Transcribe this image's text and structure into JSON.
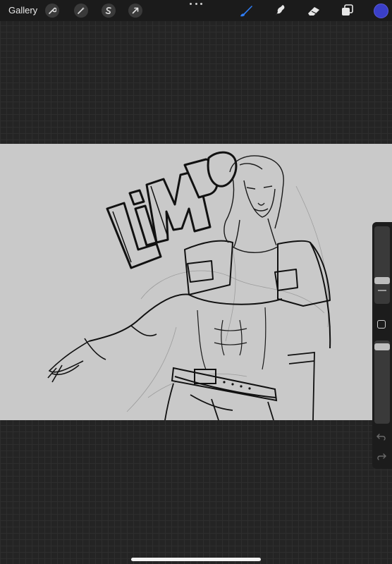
{
  "topbar": {
    "gallery_label": "Gallery",
    "left_tools": [
      "wrench-icon",
      "magic-wand-icon",
      "selection-s-icon",
      "transform-arrow-icon"
    ],
    "right_tools": [
      "brush-icon",
      "smudge-icon",
      "eraser-icon",
      "layers-icon"
    ],
    "active_tool": "brush-icon",
    "active_color": "#3a3fc8",
    "accent_color": "#2f7df5"
  },
  "canvas": {
    "background": "#c9c9c9",
    "artwork_text": "LiMBO"
  },
  "sidebar": {
    "brush_size_level": 0.72,
    "opacity_level": 0.95
  }
}
